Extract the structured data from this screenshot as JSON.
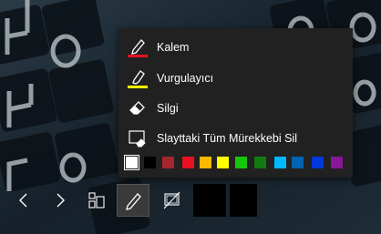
{
  "menu": {
    "items": [
      {
        "label": "Kalem",
        "icon": "pen-icon",
        "accent": "#e81123"
      },
      {
        "label": "Vurgulayıcı",
        "icon": "highlighter-icon",
        "accent": "#ffff00"
      },
      {
        "label": "Silgi",
        "icon": "eraser-icon"
      },
      {
        "label": "Slayttaki Tüm Mürekkebi Sil",
        "icon": "erase-all-ink-icon"
      }
    ],
    "colors": [
      "#ffffff",
      "#000000",
      "#a4262c",
      "#e81123",
      "#ffb900",
      "#ffff00",
      "#16c60c",
      "#107c10",
      "#00b7ff",
      "#0063b1",
      "#0037da",
      "#881798"
    ],
    "selected_color_index": 0
  },
  "toolbar": {
    "buttons": [
      {
        "name": "previous-slide",
        "icon": "chevron-left-icon"
      },
      {
        "name": "next-slide",
        "icon": "chevron-right-icon"
      },
      {
        "name": "see-all-slides",
        "icon": "slides-grid-icon"
      },
      {
        "name": "pen-tools",
        "icon": "pen-icon",
        "active": true
      },
      {
        "name": "zoom-screen",
        "icon": "screen-toggle-icon"
      }
    ]
  }
}
